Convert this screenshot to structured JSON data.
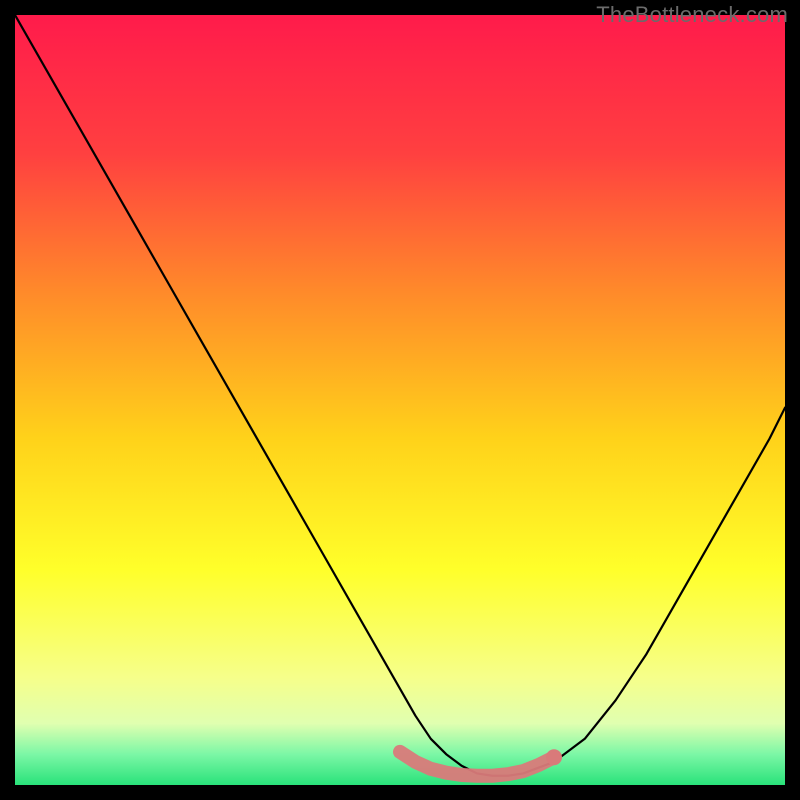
{
  "watermark": "TheBottleneck.com",
  "chart_data": {
    "type": "line",
    "title": "",
    "xlabel": "",
    "ylabel": "",
    "xlim": [
      0,
      100
    ],
    "ylim": [
      0,
      100
    ],
    "grid": false,
    "background_gradient": [
      {
        "stop": 0.0,
        "color": "#ff1b4b"
      },
      {
        "stop": 0.18,
        "color": "#ff4040"
      },
      {
        "stop": 0.36,
        "color": "#ff8a2a"
      },
      {
        "stop": 0.55,
        "color": "#ffd21a"
      },
      {
        "stop": 0.72,
        "color": "#ffff2a"
      },
      {
        "stop": 0.86,
        "color": "#f6ff8a"
      },
      {
        "stop": 0.92,
        "color": "#e0ffb0"
      },
      {
        "stop": 0.96,
        "color": "#7cf7a6"
      },
      {
        "stop": 1.0,
        "color": "#29e27a"
      }
    ],
    "series": [
      {
        "name": "curve",
        "stroke": "#000000",
        "x": [
          0,
          4,
          8,
          12,
          16,
          20,
          24,
          28,
          32,
          36,
          40,
          44,
          48,
          52,
          54,
          56,
          58,
          60,
          62,
          64,
          66,
          70,
          74,
          78,
          82,
          86,
          90,
          94,
          98,
          100
        ],
        "y": [
          100,
          93,
          86,
          79,
          72,
          65,
          58,
          51,
          44,
          37,
          30,
          23,
          16,
          9,
          6,
          4,
          2.5,
          1.5,
          1.2,
          1.2,
          1.5,
          3,
          6,
          11,
          17,
          24,
          31,
          38,
          45,
          49
        ]
      }
    ],
    "highlight_band": {
      "color": "#d97a7a",
      "x": [
        50,
        52,
        54,
        56,
        58,
        60,
        62,
        64,
        66,
        68,
        70
      ],
      "y": [
        4.3,
        3.0,
        2.1,
        1.6,
        1.3,
        1.2,
        1.2,
        1.4,
        1.8,
        2.6,
        3.6
      ],
      "dot_x": [
        70
      ],
      "dot_y": [
        3.6
      ]
    }
  }
}
